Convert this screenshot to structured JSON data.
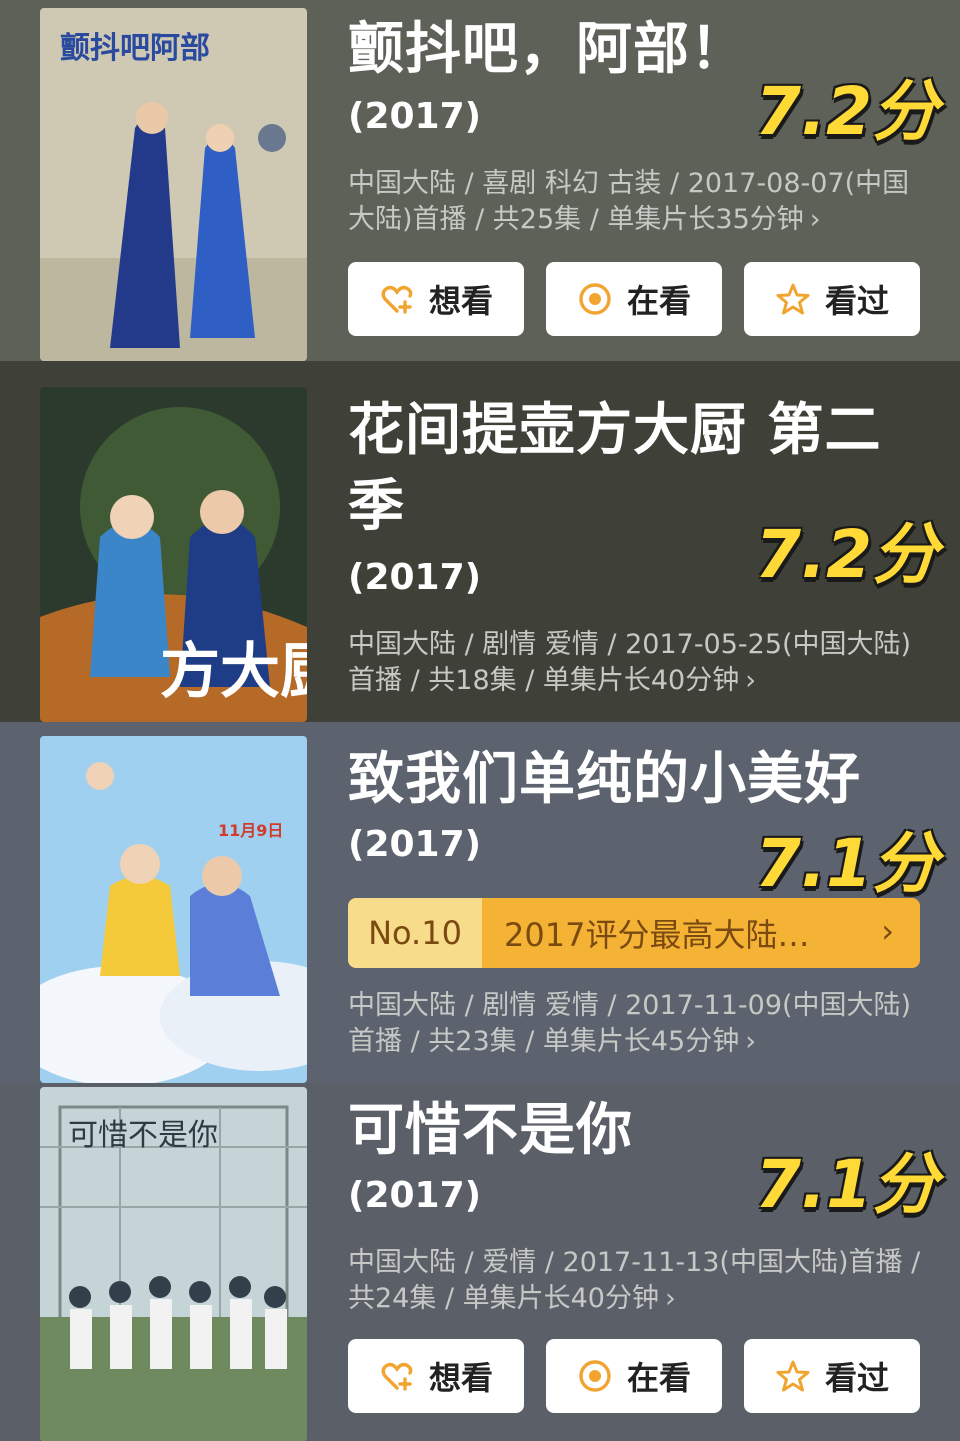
{
  "actions": {
    "want": "想看",
    "watching": "在看",
    "watched": "看过"
  },
  "entries": [
    {
      "title": "颤抖吧，阿部！",
      "year": "(2017)",
      "score": "7.2分",
      "meta": "中国大陆 / 喜剧 科幻 古装 / 2017-08-07(中国大陆)首播 / 共25集 / 单集片长35分钟",
      "poster_text": "颤抖吧阿部"
    },
    {
      "title": "花间提壶方大厨 第二季",
      "year": "(2017)",
      "score": "7.2分",
      "meta": "中国大陆 / 剧情 爱情 / 2017-05-25(中国大陆)首播 / 共18集 / 单集片长40分钟",
      "poster_text": "方大厨"
    },
    {
      "title": "致我们单纯的小美好",
      "year": "(2017)",
      "score": "7.1分",
      "rank_no": "No.10",
      "rank_text": "2017评分最高大陆…",
      "meta": "中国大陆 / 剧情 爱情 / 2017-11-09(中国大陆)首播 / 共23集 / 单集片长45分钟",
      "poster_text": "11月9日"
    },
    {
      "title": "可惜不是你",
      "year": "(2017)",
      "score": "7.1分",
      "meta": "中国大陆 / 爱情 / 2017-11-13(中国大陆)首播 / 共24集 / 单集片长40分钟",
      "poster_text": "可惜不是你"
    }
  ],
  "chevron": "›"
}
